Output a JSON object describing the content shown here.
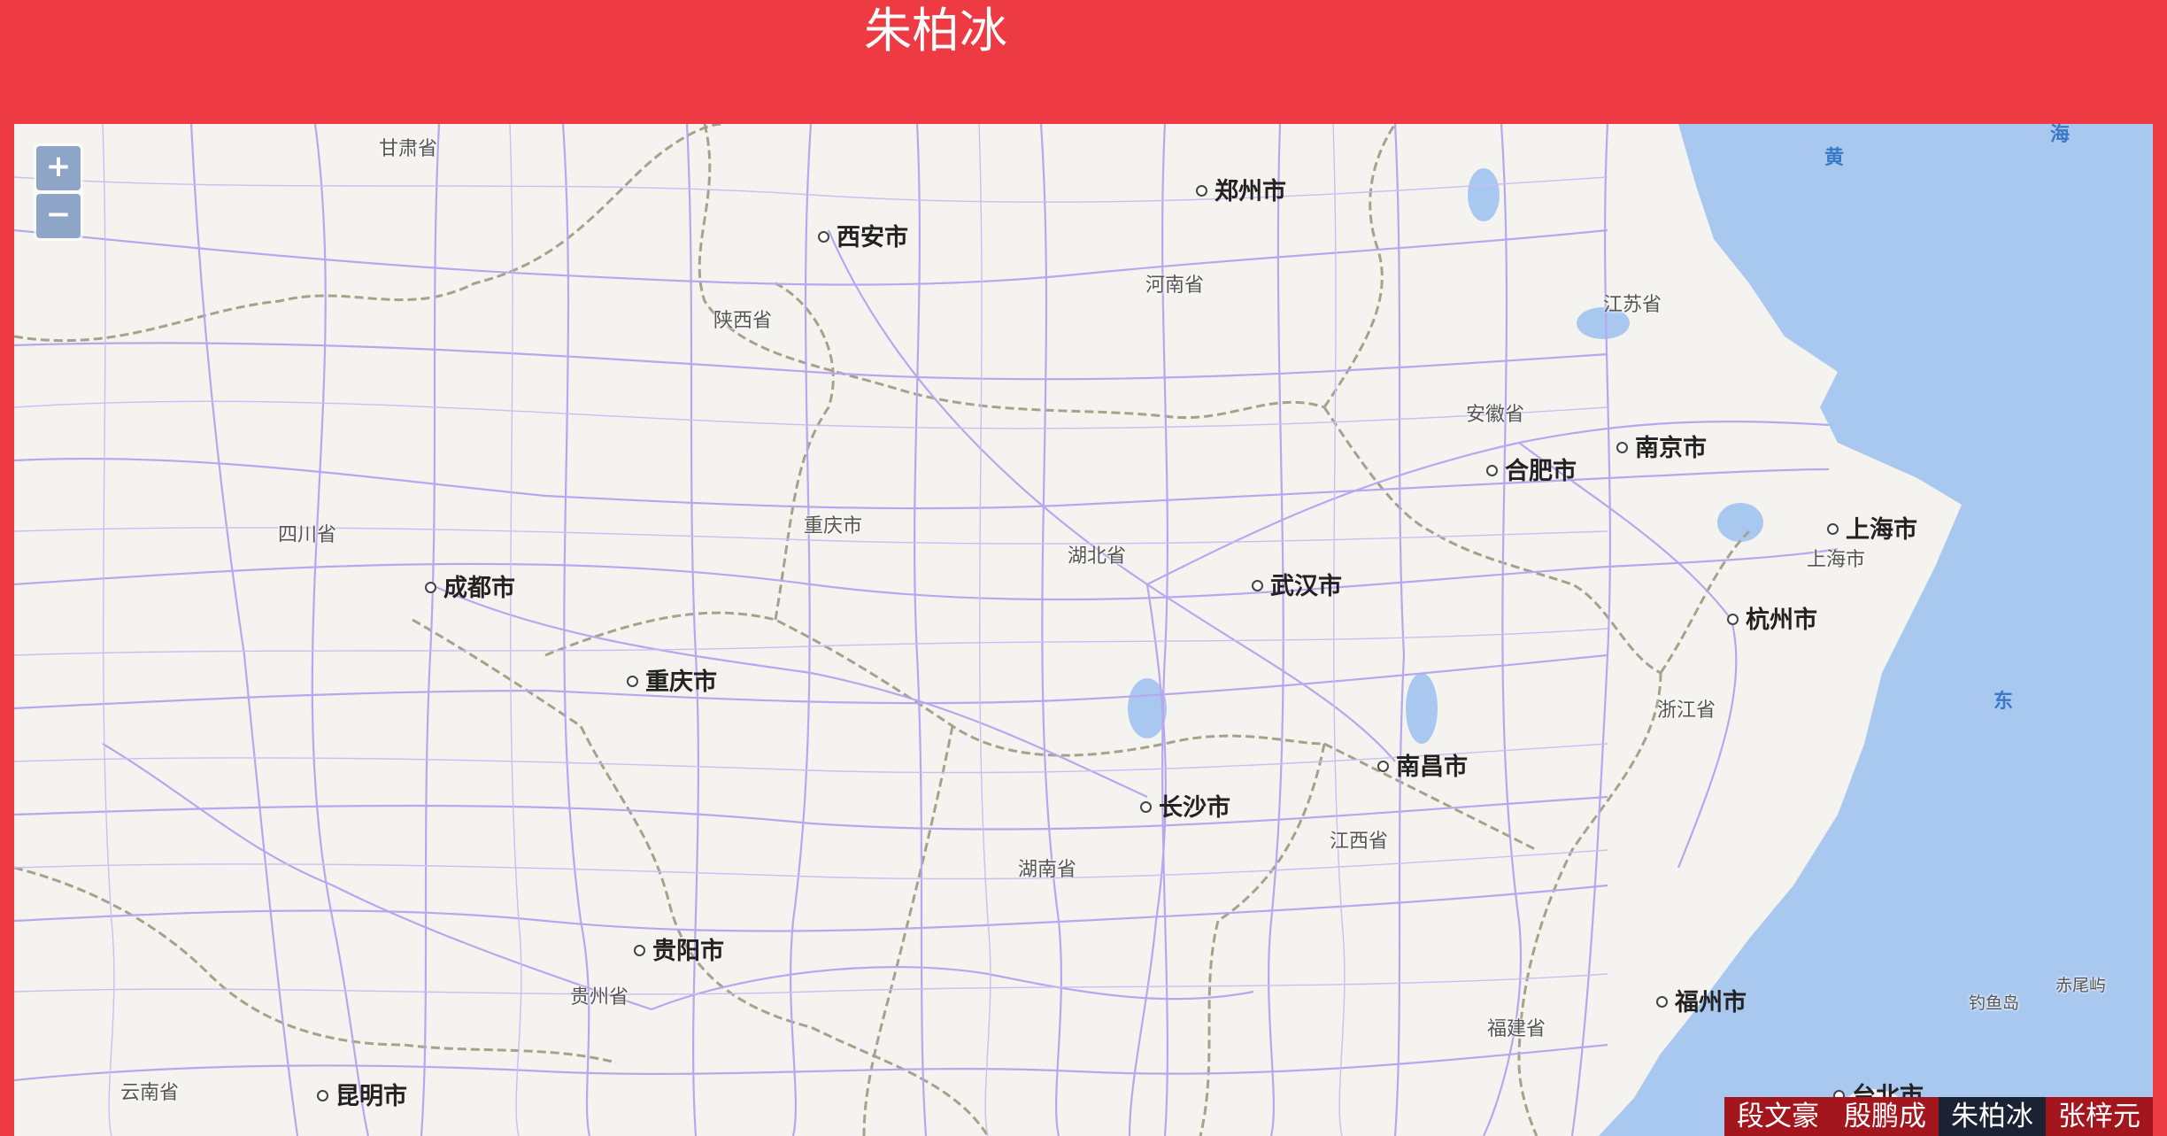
{
  "header": {
    "title": "朱柏冰"
  },
  "zoom": {
    "in_label": "+",
    "out_label": "−"
  },
  "cities": [
    {
      "name": "郑州市"
    },
    {
      "name": "西安市"
    },
    {
      "name": "南京市"
    },
    {
      "name": "合肥市"
    },
    {
      "name": "上海市"
    },
    {
      "name": "成都市"
    },
    {
      "name": "武汉市"
    },
    {
      "name": "杭州市"
    },
    {
      "name": "重庆市"
    },
    {
      "name": "南昌市"
    },
    {
      "name": "长沙市"
    },
    {
      "name": "贵阳市"
    },
    {
      "name": "福州市"
    },
    {
      "name": "昆明市"
    },
    {
      "name": "台北市"
    }
  ],
  "provinces": [
    {
      "name": "甘肃省"
    },
    {
      "name": "河南省"
    },
    {
      "name": "陕西省"
    },
    {
      "name": "江苏省"
    },
    {
      "name": "安徽省"
    },
    {
      "name": "四川省"
    },
    {
      "name": "重庆市"
    },
    {
      "name": "湖北省"
    },
    {
      "name": "上海市"
    },
    {
      "name": "浙江省"
    },
    {
      "name": "江西省"
    },
    {
      "name": "湖南省"
    },
    {
      "name": "贵州省"
    },
    {
      "name": "福建省"
    },
    {
      "name": "云南省"
    },
    {
      "name": "钓鱼岛"
    },
    {
      "name": "赤尾屿"
    }
  ],
  "seas": [
    {
      "name": "黄"
    },
    {
      "name": "海"
    },
    {
      "name": "东"
    }
  ],
  "tabs": [
    {
      "label": "段文豪",
      "active": false
    },
    {
      "label": "殷鹏成",
      "active": false
    },
    {
      "label": "朱柏冰",
      "active": true
    },
    {
      "label": "张梓元",
      "active": false
    }
  ],
  "colors": {
    "header_bg": "#ee3a42",
    "land": "#f4f3ef",
    "sea": "#a9c8f0",
    "road": "#b9a6ee",
    "border": "#a8a18a",
    "tab_bg": "#a4161d",
    "tab_active_bg": "#1a2233"
  }
}
